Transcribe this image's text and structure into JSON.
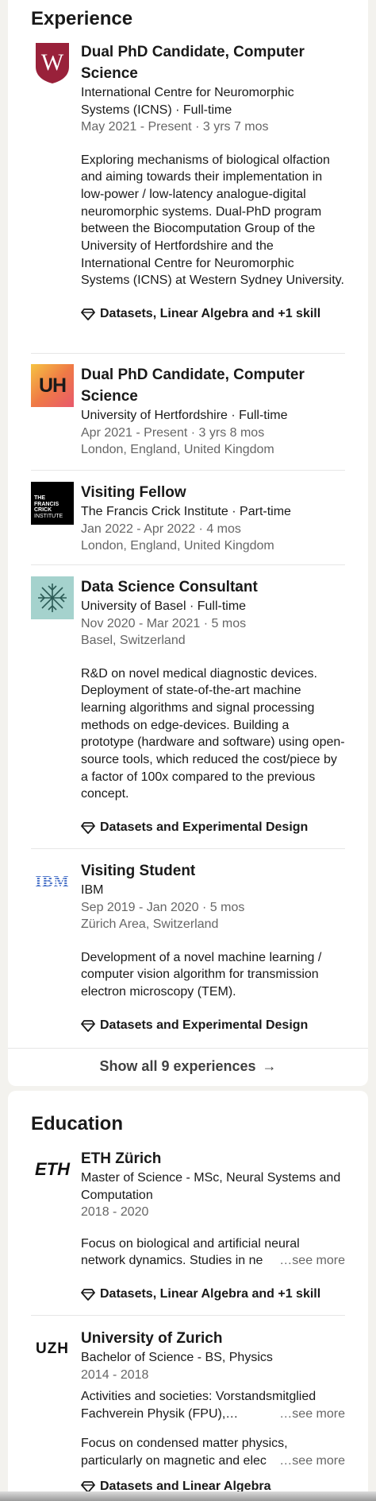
{
  "experience": {
    "heading": "Experience",
    "entries": [
      {
        "title": "Dual PhD Candidate, Computer Science",
        "company": "International Centre for Neuromorphic Systems (ICNS) · Full-time",
        "dates": "May 2021 - Present · 3 yrs 7 mos",
        "description": "Exploring mechanisms of biological olfaction and aiming towards their implementation in low-power / low-latency analogue-digital neuromorphic systems. Dual-PhD program between the Biocomputation Group of the University of Hertfordshire and the International Centre for Neuromorphic Systems (ICNS) at Western Sydney University.",
        "skills": "Datasets, Linear Algebra and +1 skill",
        "logo_letter": "W"
      },
      {
        "title": "Dual PhD Candidate, Computer Science",
        "company": "University of Hertfordshire · Full-time",
        "dates": "Apr 2021 - Present · 3 yrs 8 mos",
        "location": "London, England, United Kingdom",
        "logo_text": "UH"
      },
      {
        "title": "Visiting Fellow",
        "company": "The Francis Crick Institute · Part-time",
        "dates": "Jan 2022 - Apr 2022 · 4 mos",
        "location": "London, England, United Kingdom",
        "logo_lines": [
          "THE",
          "FRANCIS",
          "CRICK",
          "INSTITUTE"
        ]
      },
      {
        "title": "Data Science Consultant",
        "company": "University of Basel · Full-time",
        "dates": "Nov 2020 - Mar 2021 · 5 mos",
        "location": "Basel, Switzerland",
        "description": "R&D on novel medical diagnostic devices. Deployment of state-of-the-art machine learning algorithms and signal processing methods on edge-devices. Building a prototype (hardware and software) using open-source tools, which reduced the cost/piece by a factor of 100x compared to the previous concept.",
        "skills": "Datasets and Experimental Design"
      },
      {
        "title": "Visiting Student",
        "company": "IBM",
        "dates": "Sep 2019 - Jan 2020 · 5 mos",
        "location": "Zürich Area, Switzerland",
        "description": "Development of a novel machine learning / computer vision algorithm for transmission electron microscopy (TEM).",
        "skills": "Datasets and Experimental Design",
        "logo_text": "IBM"
      }
    ],
    "show_all": "Show all 9 experiences",
    "show_all_arrow": "→"
  },
  "education": {
    "heading": "Education",
    "entries": [
      {
        "school": "ETH Zürich",
        "degree": "Master of Science - MSc, Neural Systems and Computation",
        "dates": "2018 - 2020",
        "description": "Focus on biological and artificial neural network dynamics. Studies in ne",
        "see_more": "…see more",
        "skills": "Datasets, Linear Algebra and +1 skill",
        "logo_text": "ETH"
      },
      {
        "school": "University of Zurich",
        "degree": "Bachelor of Science - BS, Physics",
        "dates": "2014 - 2018",
        "activities": "Activities and societies: Vorstandsmitglied Fachverein Physik (FPU),…",
        "activities_see_more": "…see more",
        "description": "Focus on condensed matter physics, particularly on magnetic and elec",
        "see_more": "…see more",
        "skills": "Datasets and Linear Algebra",
        "logo_text": "UZH"
      }
    ]
  },
  "colors": {
    "page_bg": "#f3f2ee",
    "card_bg": "#ffffff",
    "wsu_red": "#99213a",
    "uh_orange": "#f0a33b",
    "crick_black": "#000000",
    "basel_teal": "#a5d2cd",
    "ibm_blue": "#4c74c9"
  }
}
